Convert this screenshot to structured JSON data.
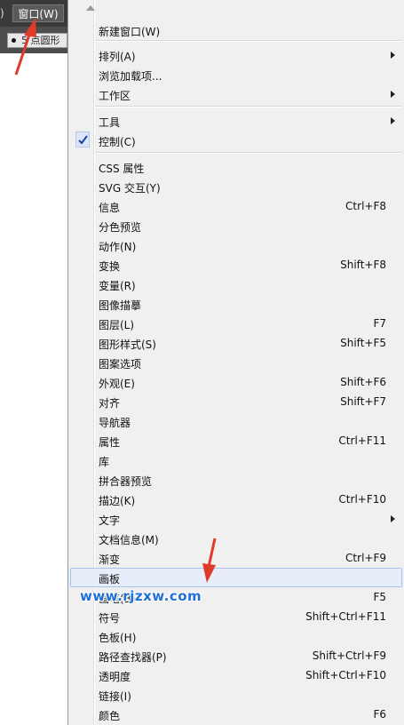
{
  "menubar": {
    "paren_fragment": ")",
    "window_menu_label": "窗口(W)"
  },
  "toolbar": {
    "chip_text": "5 点圆形"
  },
  "menu": {
    "items": [
      {
        "label": "新建窗口(W)"
      },
      {
        "label": "排列(A)",
        "submenu": true
      },
      {
        "label": "浏览加载项..."
      },
      {
        "label": "工作区",
        "submenu": true
      },
      {
        "label": "工具",
        "submenu": true
      },
      {
        "label": "控制(C)",
        "checked": true
      },
      {
        "label": "CSS 属性"
      },
      {
        "label": "SVG 交互(Y)"
      },
      {
        "label": "信息",
        "shortcut": "Ctrl+F8"
      },
      {
        "label": "分色预览"
      },
      {
        "label": "动作(N)"
      },
      {
        "label": "变换",
        "shortcut": "Shift+F8"
      },
      {
        "label": "变量(R)"
      },
      {
        "label": "图像描摹"
      },
      {
        "label": "图层(L)",
        "shortcut": "F7"
      },
      {
        "label": "图形样式(S)",
        "shortcut": "Shift+F5"
      },
      {
        "label": "图案选项"
      },
      {
        "label": "外观(E)",
        "shortcut": "Shift+F6"
      },
      {
        "label": "对齐",
        "shortcut": "Shift+F7"
      },
      {
        "label": "导航器"
      },
      {
        "label": "属性",
        "shortcut": "Ctrl+F11"
      },
      {
        "label": "库"
      },
      {
        "label": "拼合器预览"
      },
      {
        "label": "描边(K)",
        "shortcut": "Ctrl+F10"
      },
      {
        "label": "文字",
        "submenu": true
      },
      {
        "label": "文档信息(M)"
      },
      {
        "label": "渐变",
        "shortcut": "Ctrl+F9"
      },
      {
        "label": "画板",
        "highlighted": true
      },
      {
        "label": "画笔(B)",
        "shortcut": "F5"
      },
      {
        "label": "符号",
        "shortcut": "Shift+Ctrl+F11"
      },
      {
        "label": "色板(H)"
      },
      {
        "label": "路径查找器(P)",
        "shortcut": "Shift+Ctrl+F9"
      },
      {
        "label": "透明度",
        "shortcut": "Shift+Ctrl+F10"
      },
      {
        "label": "链接(I)"
      },
      {
        "label": "颜色",
        "shortcut": "F6"
      }
    ]
  },
  "watermark": "www.rjzxw.com",
  "colors": {
    "annotation_arrow": "#e03a2a",
    "watermark": "#1e6fd8",
    "checkmark": "#1b3fa8"
  }
}
